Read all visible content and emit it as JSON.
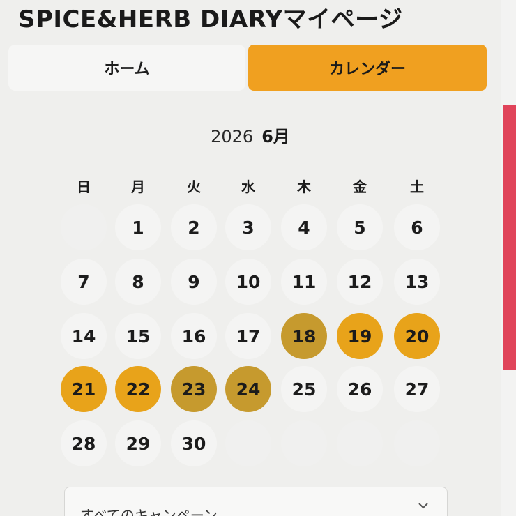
{
  "header": {
    "title": "SPICE&HERB DIARYマイページ"
  },
  "tabs": [
    {
      "label": "ホーム",
      "active": false
    },
    {
      "label": "カレンダー",
      "active": true
    }
  ],
  "calendar": {
    "year": "2026",
    "month": "6月",
    "weekdays": [
      "日",
      "月",
      "火",
      "水",
      "木",
      "金",
      "土"
    ],
    "weeks": [
      [
        "",
        "1",
        "2",
        "3",
        "4",
        "5",
        "6"
      ],
      [
        "7",
        "8",
        "9",
        "10",
        "11",
        "12",
        "13"
      ],
      [
        "14",
        "15",
        "16",
        "17",
        "18",
        "19",
        "20"
      ],
      [
        "21",
        "22",
        "23",
        "24",
        "25",
        "26",
        "27"
      ],
      [
        "28",
        "29",
        "30",
        "",
        "",
        "",
        ""
      ]
    ],
    "highlighted_days": [
      "18",
      "19",
      "20",
      "21",
      "22",
      "23",
      "24"
    ],
    "highlight_color": "#e8a31a"
  },
  "filter": {
    "value": "すべてのキャンペーン",
    "icon": "chevron-down-icon"
  },
  "colors": {
    "accent": "#f0a020",
    "background": "#efefed"
  }
}
